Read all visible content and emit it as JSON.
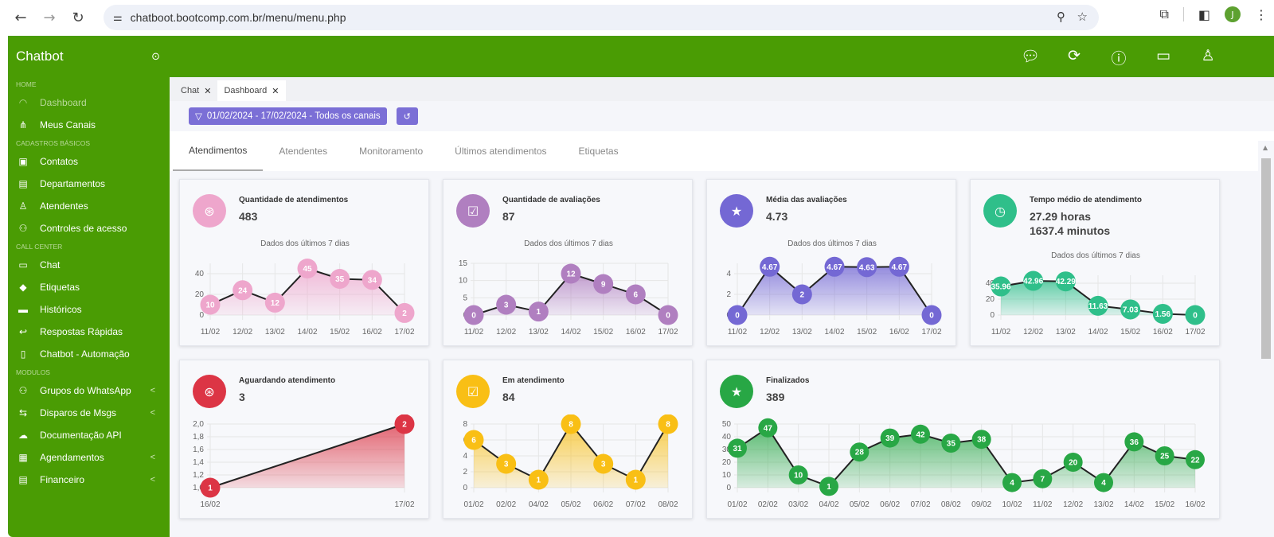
{
  "browser": {
    "url": "chatboot.bootcomp.com.br/menu/menu.php",
    "profile_initial": "J"
  },
  "sidebar": {
    "brand": "Chatbot",
    "sections": [
      {
        "label": "HOME",
        "items": [
          {
            "label": "Dashboard",
            "icon": "gauge-icon",
            "glyph": "◠",
            "active": true
          },
          {
            "label": "Meus Canais",
            "icon": "sitemap-icon",
            "glyph": "⋔"
          }
        ]
      },
      {
        "label": "CADASTROS BÁSICOS",
        "items": [
          {
            "label": "Contatos",
            "icon": "contact-card-icon",
            "glyph": "▣"
          },
          {
            "label": "Departamentos",
            "icon": "document-icon",
            "glyph": "▤"
          },
          {
            "label": "Atendentes",
            "icon": "user-icon",
            "glyph": "♙"
          },
          {
            "label": "Controles de acesso",
            "icon": "users-icon",
            "glyph": "⚇"
          }
        ]
      },
      {
        "label": "CALL CENTER",
        "items": [
          {
            "label": "Chat",
            "icon": "chat-icon",
            "glyph": "▭"
          },
          {
            "label": "Etiquetas",
            "icon": "tag-icon",
            "glyph": "◆"
          },
          {
            "label": "Históricos",
            "icon": "folder-icon",
            "glyph": "▬"
          },
          {
            "label": "Respostas Rápidas",
            "icon": "reply-icon",
            "glyph": "↩"
          },
          {
            "label": "Chatbot - Automação",
            "icon": "bookmark-icon",
            "glyph": "▯"
          }
        ]
      },
      {
        "label": "MODULOS",
        "items": [
          {
            "label": "Grupos do WhatsApp",
            "icon": "group-icon",
            "glyph": "⚇",
            "chevron": true
          },
          {
            "label": "Disparos de Msgs",
            "icon": "send-icon",
            "glyph": "⇆",
            "chevron": true
          },
          {
            "label": "Documentação API",
            "icon": "cloud-icon",
            "glyph": "☁"
          },
          {
            "label": "Agendamentos",
            "icon": "calendar-icon",
            "glyph": "▦",
            "chevron": true
          },
          {
            "label": "Financeiro",
            "icon": "invoice-icon",
            "glyph": "▤",
            "chevron": true
          }
        ]
      }
    ]
  },
  "page_tabs": [
    {
      "label": "Chat",
      "active": false
    },
    {
      "label": "Dashboard",
      "active": true
    }
  ],
  "filter": {
    "label": "01/02/2024 - 17/02/2024 - Todos os canais"
  },
  "subtabs": [
    "Atendimentos",
    "Atendentes",
    "Monitoramento",
    "Últimos atendimentos",
    "Etiquetas"
  ],
  "colors": {
    "brand_green": "#4a9c04",
    "filter_purple": "#7b6fd6",
    "pink": "#eea6cc",
    "lilac": "#b07fc0",
    "indigo": "#7468d4",
    "teal": "#2fbf8a",
    "red": "#dc3545",
    "yellow": "#f9bf15",
    "green": "#28a745"
  },
  "cards": [
    {
      "title": "Quantidade de atendimentos",
      "value": "483",
      "subtitle": "Dados dos últimos 7 dias",
      "icon": "user-circle-icon",
      "color": "#eea6cc",
      "chart": {
        "type": "area",
        "categories": [
          "11/02",
          "12/02",
          "13/02",
          "14/02",
          "15/02",
          "16/02",
          "17/02"
        ],
        "values": [
          10,
          24,
          12,
          45,
          35,
          34,
          2
        ],
        "yticks": [
          "0",
          "20",
          "40"
        ],
        "ylim": [
          0,
          50
        ]
      }
    },
    {
      "title": "Quantidade de avaliações",
      "value": "87",
      "subtitle": "Dados dos últimos 7 dias",
      "icon": "clipboard-check-icon",
      "color": "#b07fc0",
      "chart": {
        "type": "area",
        "categories": [
          "11/02",
          "12/02",
          "13/02",
          "14/02",
          "15/02",
          "16/02",
          "17/02"
        ],
        "values": [
          0,
          3,
          1,
          12,
          9,
          6,
          0
        ],
        "yticks": [
          "0",
          "5",
          "10",
          "15"
        ],
        "ylim": [
          0,
          15
        ]
      }
    },
    {
      "title": "Média das avaliações",
      "value": "4.73",
      "subtitle": "Dados dos últimos 7 dias",
      "icon": "star-icon",
      "color": "#7468d4",
      "chart": {
        "type": "area",
        "categories": [
          "11/02",
          "12/02",
          "13/02",
          "14/02",
          "15/02",
          "16/02",
          "17/02"
        ],
        "values": [
          0,
          4.67,
          2,
          4.67,
          4.63,
          4.67,
          0
        ],
        "yticks": [
          "0",
          "2",
          "4"
        ],
        "ylim": [
          0,
          5
        ]
      }
    },
    {
      "title": "Tempo médio de atendimento",
      "value": "27.29 horas",
      "value2": "1637.4 minutos",
      "subtitle": "Dados dos últimos 7 dias",
      "icon": "clock-icon",
      "color": "#2fbf8a",
      "chart": {
        "type": "area",
        "categories": [
          "11/02",
          "12/02",
          "13/02",
          "14/02",
          "15/02",
          "16/02",
          "17/02"
        ],
        "values": [
          35.96,
          42.96,
          42.29,
          11.63,
          7.03,
          1.56,
          0
        ],
        "yticks": [
          "0",
          "20",
          "40"
        ],
        "ylim": [
          0,
          50
        ]
      }
    },
    {
      "title": "Aguardando atendimento",
      "value": "3",
      "icon": "user-circle-icon",
      "color": "#dc3545",
      "chart": {
        "type": "area",
        "categories": [
          "16/02",
          "17/02"
        ],
        "values": [
          1,
          2
        ],
        "yticks": [
          "1,0",
          "1,2",
          "1,4",
          "1,6",
          "1,8",
          "2,0"
        ],
        "ylim": [
          1,
          2
        ]
      }
    },
    {
      "title": "Em atendimento",
      "value": "84",
      "icon": "clipboard-check-icon",
      "color": "#f9bf15",
      "chart": {
        "type": "area",
        "categories": [
          "01/02",
          "02/02",
          "04/02",
          "05/02",
          "06/02",
          "07/02",
          "08/02"
        ],
        "values": [
          6,
          3,
          1,
          8,
          3,
          1,
          8
        ],
        "yticks": [
          "0",
          "2",
          "4",
          "6",
          "8"
        ],
        "ylim": [
          0,
          8
        ]
      }
    },
    {
      "title": "Finalizados",
      "value": "389",
      "icon": "star-icon",
      "color": "#28a745",
      "chart": {
        "type": "area",
        "categories": [
          "01/02",
          "02/02",
          "03/02",
          "04/02",
          "05/02",
          "06/02",
          "07/02",
          "08/02",
          "09/02",
          "10/02",
          "11/02",
          "12/02",
          "13/02",
          "14/02",
          "15/02",
          "16/02"
        ],
        "values": [
          31,
          47,
          10,
          1,
          28,
          39,
          42,
          35,
          38,
          4,
          7,
          20,
          4,
          36,
          25,
          22
        ],
        "yticks": [
          "0",
          "10",
          "20",
          "30",
          "40",
          "50"
        ],
        "ylim": [
          0,
          50
        ]
      }
    }
  ]
}
